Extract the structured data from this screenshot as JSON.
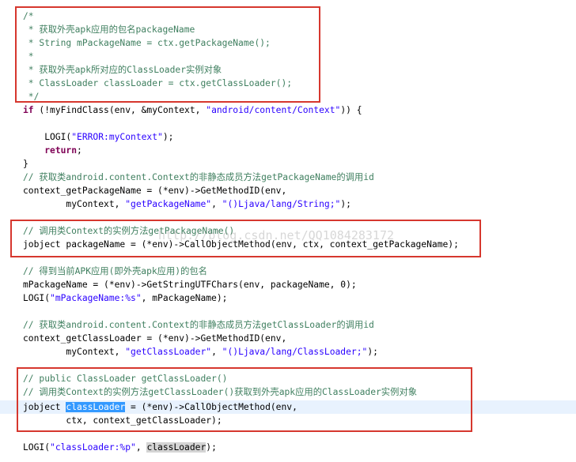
{
  "code": {
    "l1": "/*",
    "l2": " * 获取外壳apk应用的包名packageName",
    "l3": " * String mPackageName = ctx.getPackageName();",
    "l4": " *",
    "l5": " * 获取外壳apk所对应的ClassLoader实例对象",
    "l6": " * ClassLoader classLoader = ctx.getClassLoader();",
    "l7": " */",
    "l8": {
      "kw": "if",
      "pre": " (!myFindClass(env, &myContext, ",
      "str": "\"android/content/Context\"",
      "post": ")) {"
    },
    "l10": {
      "pre": "    LOGI(",
      "str": "\"ERROR:myContext\"",
      "post": ");"
    },
    "l11": {
      "kw": "return",
      "post": ";"
    },
    "l12": "}",
    "l13": "// 获取类android.content.Context的非静态成员方法getPackageName的调用id",
    "l14": "context_getPackageName = (*env)->GetMethodID(env,",
    "l15": {
      "pre": "        myContext, ",
      "s1": "\"getPackageName\"",
      "mid": ", ",
      "s2": "\"()Ljava/lang/String;\"",
      "post": ");"
    },
    "l17": "// 调用类Context的实例方法getPackageName()",
    "l18": "jobject packageName = (*env)->CallObjectMethod(env, ctx, context_getPackageName);",
    "l20": "// 得到当前APK应用(即外壳apk应用)的包名",
    "l21": "mPackageName = (*env)->GetStringUTFChars(env, packageName, 0);",
    "l22": {
      "pre": "LOGI(",
      "str": "\"mPackageName:%s\"",
      "post": ", mPackageName);"
    },
    "l24": "// 获取类android.content.Context的非静态成员方法getClassLoader的调用id",
    "l25": "context_getClassLoader = (*env)->GetMethodID(env,",
    "l26": {
      "pre": "        myContext, ",
      "s1": "\"getClassLoader\"",
      "mid": ", ",
      "s2": "\"()Ljava/lang/ClassLoader;\"",
      "post": ");"
    },
    "l28": "// public ClassLoader getClassLoader()",
    "l29": "// 调用类Context的实例方法getClassLoader()获取到外壳apk应用的ClassLoader实例对象",
    "l30": {
      "pre": "jobject ",
      "sel": "classLoader",
      "post": " = (*env)->CallObjectMethod(env,"
    },
    "l31": "        ctx, context_getClassLoader);",
    "l33": {
      "pre": "LOGI(",
      "str": "\"classLoader:%p\"",
      "mid": ", ",
      "occ": "classLoader",
      "post": ");"
    }
  },
  "watermark": "http://blog.csdn.net/QQ1084283172",
  "colors": {
    "comment": "#3f7f5f",
    "keyword": "#7f0055",
    "string": "#2a00ff",
    "highlight_box": "#d6372e"
  }
}
